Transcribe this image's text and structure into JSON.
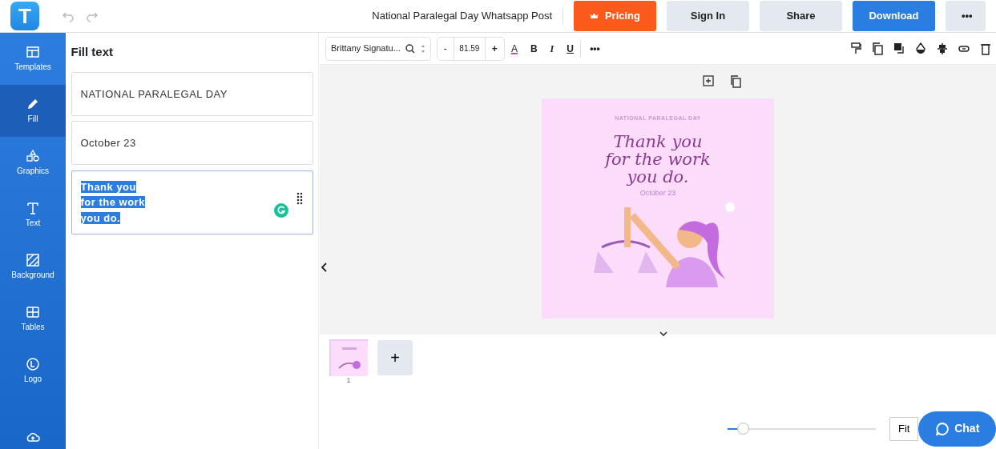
{
  "header": {
    "logo": "T",
    "title": "National Paralegal Day Whatsapp Post",
    "buttons": [
      {
        "label": "Pricing",
        "kind": "pricing"
      },
      {
        "label": "Sign In",
        "kind": "plain"
      },
      {
        "label": "Share",
        "kind": "plain"
      },
      {
        "label": "Download",
        "kind": "primary"
      },
      {
        "label": "•••",
        "kind": "plain"
      }
    ]
  },
  "sidebar": {
    "items": [
      {
        "label": "Templates",
        "selected": false
      },
      {
        "label": "Fill",
        "selected": true
      },
      {
        "label": "Graphics",
        "selected": false
      },
      {
        "label": "Text",
        "selected": false
      },
      {
        "label": "Background",
        "selected": false
      },
      {
        "label": "Tables",
        "selected": false
      },
      {
        "label": "Logo",
        "selected": false
      },
      {
        "selected": false
      }
    ]
  },
  "panel": {
    "title": "Fill text",
    "fields": [
      {
        "lines": [
          "NATIONAL PARALEGAL DAY"
        ],
        "highlighted": false
      },
      {
        "lines": [
          "October 23"
        ],
        "highlighted": false
      },
      {
        "lines": [
          "Thank you",
          "for the work",
          "you do."
        ],
        "highlighted": true
      }
    ]
  },
  "toolbar": {
    "font": "Brittany Signatu...",
    "decrease": "-",
    "size": "81.59",
    "increase": "+",
    "color_letter": "A",
    "bold": "B",
    "italic": "I",
    "underline": "U",
    "more": "•••"
  },
  "design": {
    "heading": "NATIONAL PARALEGAL DAY",
    "script_lines": [
      "Thank you",
      "for the work",
      "you do."
    ],
    "date": "October 23"
  },
  "pages": [
    {
      "number": "1",
      "selected": true
    }
  ],
  "add_page": "+",
  "zoom": {
    "fit": "Fit"
  },
  "chat": "Chat"
}
